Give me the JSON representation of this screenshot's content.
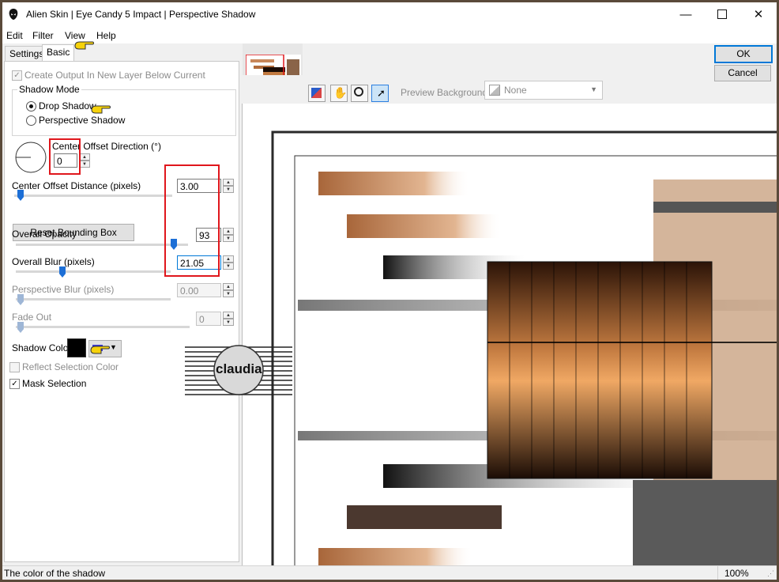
{
  "window": {
    "title": "Alien Skin | Eye Candy 5 Impact | Perspective Shadow"
  },
  "menu": {
    "edit": "Edit",
    "filter": "Filter",
    "view": "View",
    "help": "Help"
  },
  "tabs": {
    "settings": "Settings",
    "basic": "Basic"
  },
  "create_output": {
    "label": "Create Output In New Layer Below Current",
    "checked": true
  },
  "shadow_mode": {
    "title": "Shadow Mode",
    "drop": "Drop Shadow",
    "perspective": "Perspective Shadow",
    "selected": "Drop Shadow"
  },
  "center_offset_direction": {
    "label": "Center Offset Direction (°)",
    "value": "0"
  },
  "center_offset_distance": {
    "label": "Center Offset Distance (pixels)",
    "value": "3.00"
  },
  "reset_bounding_box": {
    "label": "Reset Bounding Box"
  },
  "overall_opacity": {
    "label": "Overall Opacity",
    "value": "93"
  },
  "overall_blur": {
    "label": "Overall Blur (pixels)",
    "value": "21.05"
  },
  "perspective_blur": {
    "label": "Perspective Blur (pixels)",
    "value": "0.00"
  },
  "fade_out": {
    "label": "Fade Out",
    "value": "0"
  },
  "shadow_color": {
    "label": "Shadow Color",
    "color": "#000000"
  },
  "reflect_selection_color": {
    "label": "Reflect Selection Color",
    "checked": false
  },
  "mask_selection": {
    "label": "Mask Selection",
    "checked": true
  },
  "buttons": {
    "ok": "OK",
    "cancel": "Cancel"
  },
  "preview": {
    "background_label": "Preview Background:",
    "background_value": "None"
  },
  "watermark": {
    "text": "claudia"
  },
  "status": {
    "text": "The color of the shadow",
    "zoom": "100%"
  },
  "colors": {
    "accent": "#0078d7",
    "annotation_red": "#e0161c",
    "slider_blue": "#1d6fd6"
  }
}
